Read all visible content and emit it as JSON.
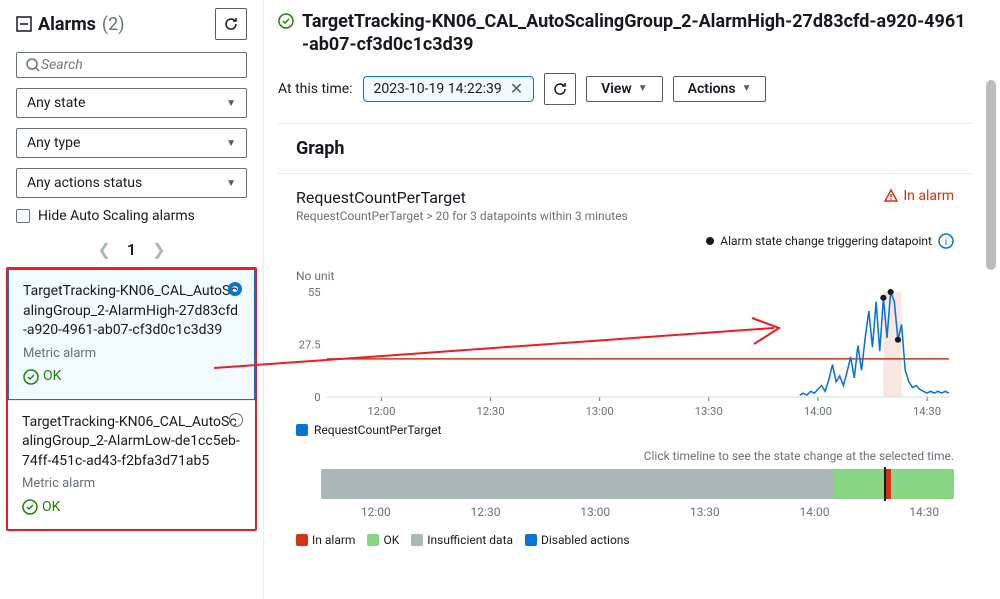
{
  "sidebar": {
    "title": "Alarms",
    "count": "(2)",
    "search_placeholder": "Search",
    "filters": {
      "state": "Any state",
      "type": "Any type",
      "actions": "Any actions status"
    },
    "hide_autoscaling_label": "Hide Auto Scaling alarms",
    "page": "1"
  },
  "alarms": [
    {
      "name": "TargetTracking-KN06_CAL_AutoScalingGroup_2-AlarmHigh-27d83cfd-a920-4961-ab07-cf3d0c1c3d39",
      "type": "Metric alarm",
      "status": "OK",
      "selected": true
    },
    {
      "name": "TargetTracking-KN06_CAL_AutoScalingGroup_2-AlarmLow-de1cc5eb-74ff-451c-ad43-f2bfa3d71ab5",
      "type": "Metric alarm",
      "status": "OK",
      "selected": false
    }
  ],
  "main": {
    "title": "TargetTracking-KN06_CAL_AutoScalingGroup_2-AlarmHigh-27d83cfd-a920-4961-ab07-cf3d0c1c3d39",
    "at_this_time_label": "At this time:",
    "timestamp": "2023-10-19 14:22:39",
    "view_label": "View",
    "actions_label": "Actions"
  },
  "panel": {
    "title": "Graph",
    "metric": "RequestCountPerTarget",
    "condition": "RequestCountPerTarget > 20 for 3 datapoints within 3 minutes",
    "status_label": "In alarm",
    "legend_note": "Alarm state change triggering datapoint",
    "unit": "No unit",
    "legend_metric": "RequestCountPerTarget",
    "timeline_note": "Click timeline to see the state change at the selected time.",
    "footer": {
      "in_alarm": "In alarm",
      "ok": "OK",
      "insufficient": "Insufficient data",
      "disabled": "Disabled actions"
    }
  },
  "chart_data": {
    "type": "line",
    "xlabel": "",
    "ylabel": "",
    "ylim": [
      0,
      55
    ],
    "threshold": 20,
    "x_ticks": [
      "12:00",
      "12:30",
      "13:00",
      "13:30",
      "14:00",
      "14:30"
    ],
    "y_ticks": [
      0,
      27.5,
      55
    ],
    "series": [
      {
        "name": "RequestCountPerTarget",
        "color": "#0972d3",
        "points": [
          {
            "t": "13:55",
            "v": 1
          },
          {
            "t": "13:56",
            "v": 2
          },
          {
            "t": "13:57",
            "v": 1
          },
          {
            "t": "13:58",
            "v": 3
          },
          {
            "t": "13:59",
            "v": 2
          },
          {
            "t": "14:00",
            "v": 4
          },
          {
            "t": "14:01",
            "v": 6
          },
          {
            "t": "14:02",
            "v": 3
          },
          {
            "t": "14:03",
            "v": 9
          },
          {
            "t": "14:04",
            "v": 17
          },
          {
            "t": "14:05",
            "v": 8
          },
          {
            "t": "14:06",
            "v": 11
          },
          {
            "t": "14:07",
            "v": 6
          },
          {
            "t": "14:08",
            "v": 13
          },
          {
            "t": "14:09",
            "v": 21
          },
          {
            "t": "14:10",
            "v": 10
          },
          {
            "t": "14:11",
            "v": 27
          },
          {
            "t": "14:12",
            "v": 14
          },
          {
            "t": "14:13",
            "v": 31
          },
          {
            "t": "14:14",
            "v": 45
          },
          {
            "t": "14:15",
            "v": 26
          },
          {
            "t": "14:16",
            "v": 50
          },
          {
            "t": "14:17",
            "v": 24
          },
          {
            "t": "14:18",
            "v": 52
          },
          {
            "t": "14:19",
            "v": 31
          },
          {
            "t": "14:20",
            "v": 55
          },
          {
            "t": "14:21",
            "v": 50
          },
          {
            "t": "14:22",
            "v": 30
          },
          {
            "t": "14:23",
            "v": 38
          },
          {
            "t": "14:24",
            "v": 14
          },
          {
            "t": "14:25",
            "v": 8
          },
          {
            "t": "14:26",
            "v": 5
          },
          {
            "t": "14:27",
            "v": 6
          },
          {
            "t": "14:28",
            "v": 4
          },
          {
            "t": "14:29",
            "v": 3
          },
          {
            "t": "14:30",
            "v": 2
          },
          {
            "t": "14:31",
            "v": 3
          },
          {
            "t": "14:32",
            "v": 2
          },
          {
            "t": "14:33",
            "v": 3
          },
          {
            "t": "14:34",
            "v": 2
          },
          {
            "t": "14:35",
            "v": 3
          },
          {
            "t": "14:36",
            "v": 2
          }
        ]
      }
    ],
    "trigger_points": [
      {
        "t": "14:18",
        "v": 52
      },
      {
        "t": "14:20",
        "v": 55
      },
      {
        "t": "14:22",
        "v": 30
      }
    ],
    "highlight_band": {
      "from": "14:18",
      "to": "14:23"
    }
  },
  "timeline": {
    "insufficient_from_pct": 0,
    "insufficient_to_pct": 81,
    "ok_from_pct": 81,
    "ok_to_pct": 100,
    "alarm_from_pct": 89,
    "alarm_to_pct": 90,
    "marker_pct": 89,
    "ticks": [
      "12:00",
      "12:30",
      "13:00",
      "13:30",
      "14:00",
      "14:30"
    ]
  },
  "colors": {
    "ok": "#1d8102",
    "ok_bar": "#88d584",
    "alarm": "#d13212",
    "insufficient": "#aab7b8",
    "disabled": "#0972d3",
    "line": "#0972d3"
  }
}
